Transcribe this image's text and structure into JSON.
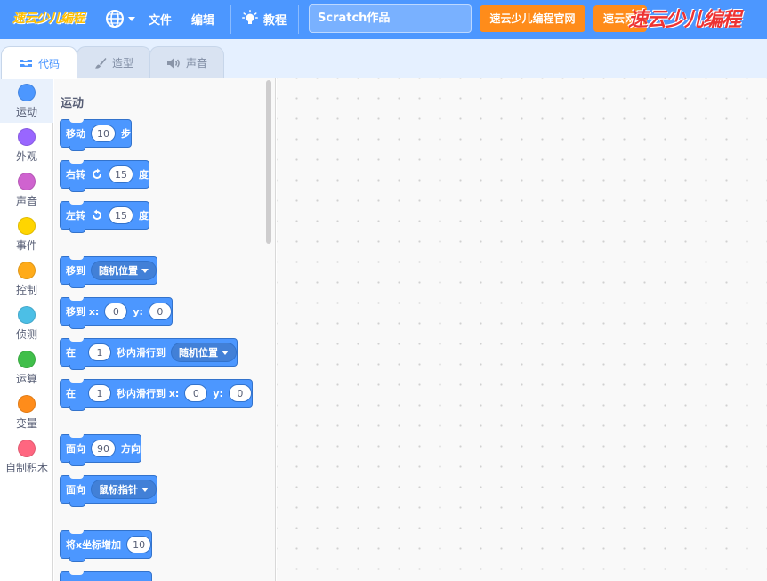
{
  "menubar": {
    "logo_text": "速云少儿编程",
    "file_label": "文件",
    "edit_label": "编辑",
    "tutorial_label": "教程",
    "project_title": "Scratch作品",
    "official_site_button": "速云少儿编程官网",
    "second_button": "速云网",
    "watermark_text": "速云少儿编程",
    "colors": {
      "bar": "#4c97ff",
      "button": "#ff8c1a"
    }
  },
  "tabs": [
    {
      "label": "代码",
      "icon": "code-icon",
      "active": true
    },
    {
      "label": "造型",
      "icon": "brush-icon",
      "active": false
    },
    {
      "label": "声音",
      "icon": "speaker-icon",
      "active": false
    }
  ],
  "categories": [
    {
      "label": "运动",
      "color": "#4c97ff"
    },
    {
      "label": "外观",
      "color": "#9966ff"
    },
    {
      "label": "声音",
      "color": "#cf63cf"
    },
    {
      "label": "事件",
      "color": "#ffd500"
    },
    {
      "label": "控制",
      "color": "#ffab19"
    },
    {
      "label": "侦测",
      "color": "#4cbfe6"
    },
    {
      "label": "运算",
      "color": "#40bf4a"
    },
    {
      "label": "变量",
      "color": "#ff8c1a"
    },
    {
      "label": "自制积木",
      "color": "#ff6680"
    }
  ],
  "palette": {
    "heading": "运动",
    "move": {
      "prefix": "移动",
      "value": "10",
      "suffix": "步"
    },
    "turn_right": {
      "prefix": "右转",
      "value": "15",
      "suffix": "度"
    },
    "turn_left": {
      "prefix": "左转",
      "value": "15",
      "suffix": "度"
    },
    "goto": {
      "prefix": "移到",
      "option": "随机位置"
    },
    "goto_xy": {
      "prefix": "移到 x:",
      "x": "0",
      "ylabel": "y:",
      "y": "0"
    },
    "glide": {
      "prefix": "在",
      "secs": "1",
      "mid": "秒内滑行到",
      "option": "随机位置"
    },
    "glide_xy": {
      "prefix": "在",
      "secs": "1",
      "mid": "秒内滑行到 x:",
      "x": "0",
      "ylabel": "y:",
      "y": "0"
    },
    "point_dir": {
      "prefix": "面向",
      "value": "90",
      "suffix": "方向"
    },
    "point_towards": {
      "prefix": "面向",
      "option": "鼠标指针"
    },
    "change_x": {
      "prefix": "将x坐标增加",
      "value": "10"
    }
  }
}
